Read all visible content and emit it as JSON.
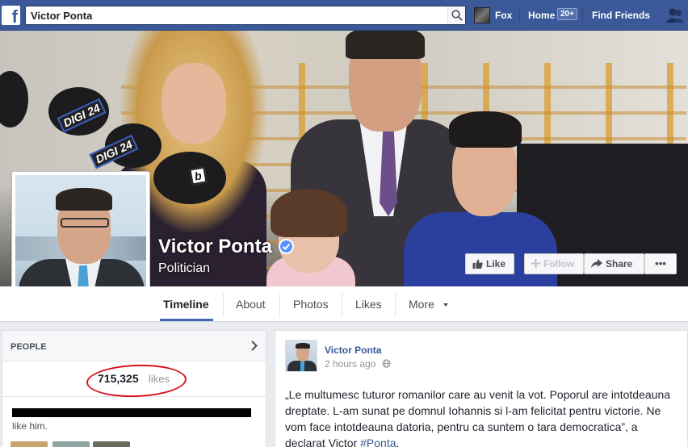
{
  "topbar": {
    "search_value": "Victor Ponta",
    "profile_name": "Fox",
    "home_label": "Home",
    "home_badge": "20+",
    "find_friends_label": "Find Friends"
  },
  "cover": {
    "mic_labels": [
      "DIGI 24",
      "DIGI 24",
      "b"
    ]
  },
  "page": {
    "name": "Victor Ponta",
    "category": "Politician"
  },
  "cover_buttons": {
    "like": "Like",
    "follow": "Follow",
    "share": "Share",
    "more": "•••"
  },
  "tabs": [
    {
      "label": "Timeline",
      "active": true
    },
    {
      "label": "About"
    },
    {
      "label": "Photos"
    },
    {
      "label": "Likes"
    },
    {
      "label": "More"
    }
  ],
  "people": {
    "title": "PEOPLE",
    "likes_count": "715,325",
    "likes_word": "likes",
    "friends_text": "like him."
  },
  "post": {
    "author": "Victor Ponta",
    "time": "2 hours ago",
    "text": "„Le multumesc tuturor romanilor care au venit la vot. Poporul are intotdeauna dreptate. L-am sunat pe domnul Iohannis si l-am felicitat pentru victorie. Ne vom face intotdeauna datoria, pentru ca suntem o tara democratica”, a declarat Victor ",
    "hashtag": "#Ponta",
    "text_end": "."
  },
  "colors": {
    "brand": "#3b5998",
    "link": "#365899",
    "verified": "#5890ff",
    "annotation": "#d8101c"
  },
  "icons": [
    "facebook-logo-icon",
    "search-icon",
    "friends-icon",
    "verified-icon",
    "thumbs-up-icon",
    "plus-icon",
    "share-arrow-icon",
    "caret-down-icon",
    "chevron-right-icon",
    "globe-icon"
  ]
}
